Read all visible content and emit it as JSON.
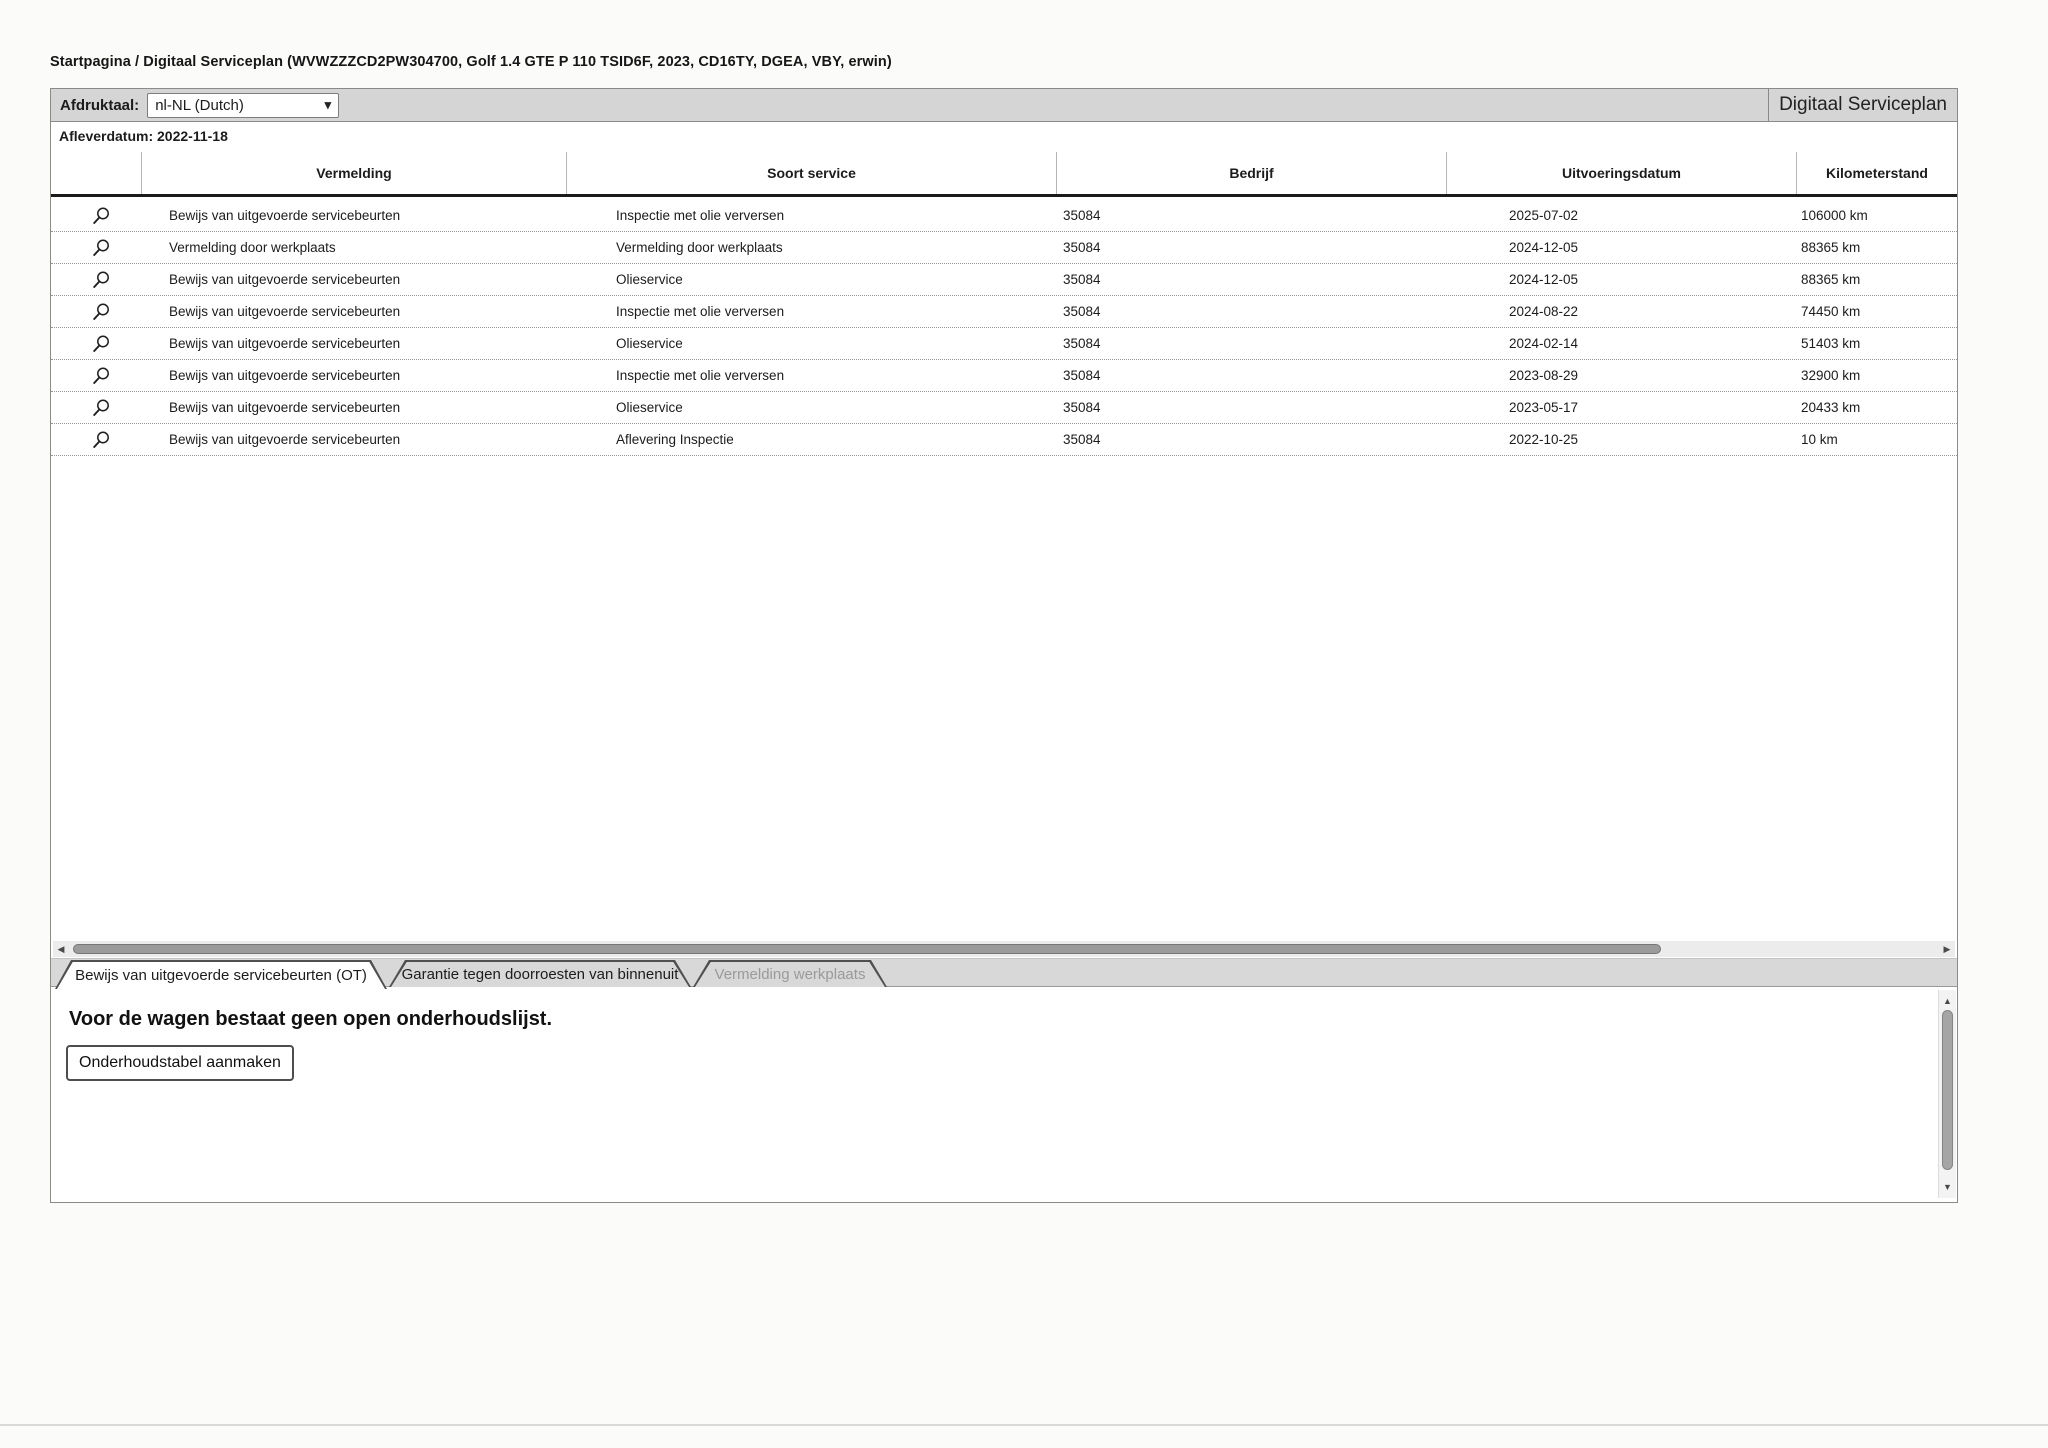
{
  "page": {
    "breadcrumb": "Startpagina / Digitaal Serviceplan (WVWZZZCD2PW304700, Golf 1.4 GTE P 110 TSID6F, 2023, CD16TY, DGEA, VBY, erwin)",
    "toolbar": {
      "print_language_label": "Afdruktaal:",
      "print_language_value": "nl-NL (Dutch)",
      "title_right": "Digitaal Serviceplan"
    },
    "delivery_date": "Afleverdatum: 2022-11-18"
  },
  "table": {
    "columns": [
      "Vermelding",
      "Soort service",
      "Bedrijf",
      "Uitvoeringsdatum",
      "Kilometerstand"
    ],
    "rows": [
      {
        "vermelding": "Bewijs van uitgevoerde servicebeurten",
        "soort": "Inspectie met olie verversen",
        "bedrijf": "35084",
        "datum": "2025-07-02",
        "km": "106000 km"
      },
      {
        "vermelding": "Vermelding door werkplaats",
        "soort": "Vermelding door werkplaats",
        "bedrijf": "35084",
        "datum": "2024-12-05",
        "km": "88365 km"
      },
      {
        "vermelding": "Bewijs van uitgevoerde servicebeurten",
        "soort": "Olieservice",
        "bedrijf": "35084",
        "datum": "2024-12-05",
        "km": "88365 km"
      },
      {
        "vermelding": "Bewijs van uitgevoerde servicebeurten",
        "soort": "Inspectie met olie verversen",
        "bedrijf": "35084",
        "datum": "2024-08-22",
        "km": "74450 km"
      },
      {
        "vermelding": "Bewijs van uitgevoerde servicebeurten",
        "soort": "Olieservice",
        "bedrijf": "35084",
        "datum": "2024-02-14",
        "km": "51403 km"
      },
      {
        "vermelding": "Bewijs van uitgevoerde servicebeurten",
        "soort": "Inspectie met olie verversen",
        "bedrijf": "35084",
        "datum": "2023-08-29",
        "km": "32900 km"
      },
      {
        "vermelding": "Bewijs van uitgevoerde servicebeurten",
        "soort": "Olieservice",
        "bedrijf": "35084",
        "datum": "2023-05-17",
        "km": "20433 km"
      },
      {
        "vermelding": "Bewijs van uitgevoerde servicebeurten",
        "soort": "Aflevering Inspectie",
        "bedrijf": "35084",
        "datum": "2022-10-25",
        "km": "10 km"
      }
    ]
  },
  "tabs": [
    {
      "label": "Bewijs van uitgevoerde servicebeurten (OT)",
      "state": "active"
    },
    {
      "label": "Garantie tegen doorroesten van binnenuit",
      "state": "normal"
    },
    {
      "label": "Vermelding werkplaats",
      "state": "disabled"
    }
  ],
  "panel": {
    "message": "Voor de wagen bestaat geen open onderhoudslijst.",
    "button_label": "Onderhoudstabel aanmaken"
  },
  "icons": {
    "magnifier": "magnifier-icon",
    "chevron_down": "▾",
    "arrow_left": "◀",
    "arrow_right": "▶",
    "arrow_up": "▲",
    "arrow_down": "▼"
  },
  "colors": {
    "toolbar_bg": "#d5d5d5",
    "tabstrip_bg": "#d8d8d8",
    "active_tab_bg": "#ffffff",
    "disabled_text": "#9a9a9a",
    "header_rule": "#1a1a1a",
    "scrollbar_thumb": "#9b9b9b"
  }
}
